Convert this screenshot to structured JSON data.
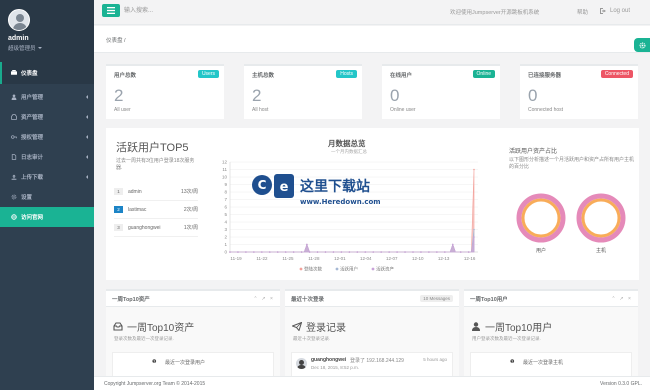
{
  "sidebar": {
    "profile": {
      "name": "admin",
      "role": "超级管理员"
    },
    "dashboard_label": "仪表盘",
    "items": [
      {
        "label": "用户管理",
        "icon": "users-icon"
      },
      {
        "label": "资产管理",
        "icon": "inbox-icon"
      },
      {
        "label": "授权管理",
        "icon": "key-icon"
      },
      {
        "label": "日志审计",
        "icon": "file-icon"
      },
      {
        "label": "上传下载",
        "icon": "upload-icon"
      },
      {
        "label": "设置",
        "icon": "gear-icon"
      },
      {
        "label": "访问官网",
        "icon": "globe-icon"
      }
    ]
  },
  "topbar": {
    "search_placeholder": "输入搜索...",
    "welcome": "欢迎使用Jumpserver开源跳板机系统",
    "help": "帮助",
    "logout": "Log out"
  },
  "breadcrumb": {
    "text": "仪表盘 /"
  },
  "stats": [
    {
      "title": "用户总数",
      "label": "Users",
      "label_color": "#23c6c8",
      "value": "2",
      "sub": "All user"
    },
    {
      "title": "主机总数",
      "label": "Hosts",
      "label_color": "#23c6c8",
      "value": "2",
      "sub": "All host"
    },
    {
      "title": "在线用户",
      "label": "Online",
      "label_color": "#1ab394",
      "value": "0",
      "sub": "Online user"
    },
    {
      "title": "已连接服务器",
      "label": "Connected",
      "label_color": "#ed5565",
      "value": "0",
      "sub": "Connected host"
    }
  ],
  "top5": {
    "title": "活跃用户TOP5",
    "desc": "过去一周共有3位用户登录18次服务器.",
    "users": [
      {
        "rank": "1",
        "name": "admin",
        "count": "13次/周"
      },
      {
        "rank": "2",
        "name": "lastimac",
        "count": "2次/周"
      },
      {
        "rank": "3",
        "name": "guanghongwei",
        "count": "1次/周"
      }
    ]
  },
  "chart_data": {
    "type": "area",
    "title": "月数据总览",
    "subtitle": "一个月内数据汇总",
    "x": [
      "11-19",
      "11-22",
      "11-25",
      "11-28",
      "12-01",
      "12-04",
      "12-07",
      "12-10",
      "12-13",
      "12-16"
    ],
    "ylim": [
      0,
      12
    ],
    "yticks": [
      0,
      1,
      2,
      3,
      4,
      5,
      6,
      7,
      8,
      9,
      10,
      11,
      12
    ],
    "series": [
      {
        "name": "登陆次数",
        "color": "#f3a19a",
        "values": [
          0,
          0,
          0,
          0,
          0,
          0,
          0,
          0,
          0,
          0,
          0,
          0,
          0,
          0,
          0,
          0,
          0,
          0,
          0,
          0,
          0,
          0,
          0,
          0,
          0,
          0,
          0,
          0,
          0,
          1,
          0,
          0,
          0,
          0,
          0,
          0,
          0,
          0,
          0,
          0,
          0,
          0,
          0,
          0,
          0,
          0,
          0,
          0,
          0,
          0,
          0,
          0,
          0,
          0,
          0,
          0,
          0,
          0,
          0,
          0,
          0,
          0,
          0,
          0,
          0,
          0,
          0,
          0,
          0,
          0,
          0,
          0,
          0,
          0,
          0,
          0,
          0,
          0,
          0,
          0,
          0,
          0,
          0,
          0,
          1,
          0,
          0,
          0,
          0,
          0,
          0,
          0,
          11
        ]
      },
      {
        "name": "活跃用户",
        "color": "#a6b8d4",
        "values": [
          0,
          0,
          0,
          0,
          0,
          0,
          0,
          0,
          0,
          0,
          0,
          0,
          0,
          0,
          0,
          0,
          0,
          0,
          0,
          0,
          0,
          0,
          0,
          0,
          0,
          0,
          0,
          0,
          0,
          1,
          0,
          0,
          0,
          0,
          0,
          0,
          0,
          0,
          0,
          0,
          0,
          0,
          0,
          0,
          0,
          0,
          0,
          0,
          0,
          0,
          0,
          0,
          0,
          0,
          0,
          0,
          0,
          0,
          0,
          0,
          0,
          0,
          0,
          0,
          0,
          0,
          0,
          0,
          0,
          0,
          0,
          0,
          0,
          0,
          0,
          0,
          0,
          0,
          0,
          0,
          0,
          0,
          0,
          0,
          1,
          0,
          0,
          0,
          0,
          0,
          0,
          0,
          3
        ]
      },
      {
        "name": "活跃资产",
        "color": "#c9a3d9",
        "values": [
          0,
          0,
          0,
          0,
          0,
          0,
          0,
          0,
          0,
          0,
          0,
          0,
          0,
          0,
          0,
          0,
          0,
          0,
          0,
          0,
          0,
          0,
          0,
          0,
          0,
          0,
          0,
          0,
          0,
          1,
          0,
          0,
          0,
          0,
          0,
          0,
          0,
          0,
          0,
          0,
          0,
          0,
          0,
          0,
          0,
          0,
          0,
          0,
          0,
          0,
          0,
          0,
          0,
          0,
          0,
          0,
          0,
          0,
          0,
          0,
          0,
          0,
          0,
          0,
          0,
          0,
          0,
          0,
          0,
          0,
          0,
          0,
          0,
          0,
          0,
          0,
          0,
          0,
          0,
          0,
          0,
          0,
          0,
          0,
          1,
          0,
          0,
          0,
          0,
          0,
          0,
          0,
          2
        ]
      }
    ]
  },
  "ratio": {
    "title": "活跃用户资产占比",
    "desc": "以下图形分析描述一个月活跃用户和资产占所有用户主机的百分比",
    "donuts": [
      {
        "label": "用户",
        "value": 1.0,
        "color": "#f8ac59",
        "track": "#e58ab9"
      },
      {
        "label": "主机",
        "value": 1.0,
        "color": "#f8ac59",
        "track": "#e58ab9"
      }
    ]
  },
  "watermark": {
    "text": "这里下载站",
    "url": "www.Heredown.com"
  },
  "panels": [
    {
      "head": "一周Top10资产",
      "title": "一周Top10资产",
      "note": "登录次数及最近一次登录记录.",
      "icon": "inbox-icon",
      "row_icon": "❶",
      "row_text": "最近一次登录用户"
    },
    {
      "head": "最近十次登录",
      "badge": "10 Messages",
      "title": "登录记录",
      "note": "最近十次登录记录.",
      "icon": "paper-plane-icon",
      "login": {
        "user": "guanghongwei",
        "text": "登录了 192.168.244.129",
        "time": "5 hours ago",
        "date": "Dec 18, 2015, 8:52 p.m."
      }
    },
    {
      "head": "一周Top10用户",
      "title": "一周Top10用户",
      "note": "用户登录次数及最近一次登录记录.",
      "icon": "user-icon",
      "row_icon": "❶",
      "row_text": "最近一次登录主机"
    }
  ],
  "footer": {
    "left": "Copyright Jumpserver.org Team © 2014-2015",
    "right": "Version 0.3.0 GPL."
  }
}
